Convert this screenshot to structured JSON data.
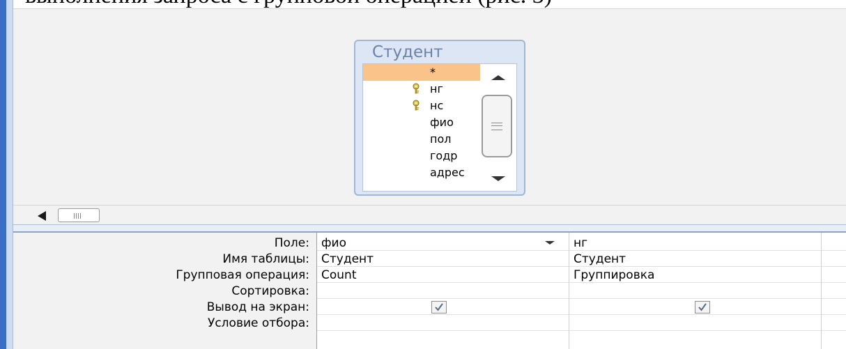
{
  "doc_text": "выполнения запроса с групповой операцией (рис. 3)",
  "table": {
    "title": "Студент",
    "fields": [
      {
        "label": "*",
        "key": false,
        "selected": true
      },
      {
        "label": "нг",
        "key": true,
        "selected": false
      },
      {
        "label": "нс",
        "key": true,
        "selected": false
      },
      {
        "label": "фио",
        "key": false,
        "selected": false
      },
      {
        "label": "пол",
        "key": false,
        "selected": false
      },
      {
        "label": "годр",
        "key": false,
        "selected": false
      },
      {
        "label": "адрес",
        "key": false,
        "selected": false
      }
    ]
  },
  "grid": {
    "row_labels": {
      "field": "Поле:",
      "table": "Имя таблицы:",
      "total": "Групповая операция:",
      "sort": "Сортировка:",
      "show": "Вывод на экран:",
      "criteria": "Условие отбора:"
    },
    "columns": [
      {
        "field": "фио",
        "table": "Студент",
        "total": "Count",
        "sort": "",
        "show": true
      },
      {
        "field": "нг",
        "table": "Студент",
        "total": "Группировка",
        "sort": "",
        "show": true
      }
    ]
  },
  "colors": {
    "selected_row": "#f9c38a",
    "frame_blue": "#3b6fc6",
    "title_blue": "#6b83a8"
  },
  "icons": {
    "key": "key-icon",
    "scroll_up": "scroll-up-arrow-icon",
    "scroll_down": "scroll-down-arrow-icon",
    "scroll_left": "scroll-left-arrow-icon",
    "combo": "chevron-down-icon",
    "check": "checkmark-icon"
  }
}
